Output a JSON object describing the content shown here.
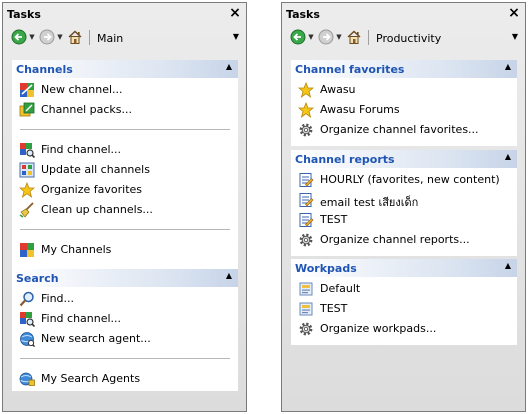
{
  "colors": {
    "group_header_text": "#1e55b4",
    "panel_bg": "#e3e3e3",
    "border": "#7a7a7a"
  },
  "left_panel": {
    "title": "Tasks",
    "toolbar": {
      "select_value": "Main"
    },
    "channels": {
      "header": "Channels",
      "items": [
        {
          "label": "New channel...",
          "icon": "new-channel-icon"
        },
        {
          "label": "Channel packs...",
          "icon": "channel-packs-icon"
        },
        {
          "label": "Find channel...",
          "icon": "find-channel-icon"
        },
        {
          "label": "Update all channels",
          "icon": "update-channels-icon"
        },
        {
          "label": "Organize favorites",
          "icon": "star-icon"
        },
        {
          "label": "Clean up channels...",
          "icon": "broom-icon"
        },
        {
          "label": "My Channels",
          "icon": "my-channels-icon"
        }
      ]
    },
    "search": {
      "header": "Search",
      "items": [
        {
          "label": "Find...",
          "icon": "magnifier-icon"
        },
        {
          "label": "Find channel...",
          "icon": "find-channel-icon"
        },
        {
          "label": "New search agent...",
          "icon": "search-agent-icon"
        },
        {
          "label": "My Search Agents",
          "icon": "search-agents-icon"
        }
      ]
    }
  },
  "right_panel": {
    "title": "Tasks",
    "toolbar": {
      "select_value": "Productivity"
    },
    "favorites": {
      "header": "Channel favorites",
      "items": [
        {
          "label": "Awasu",
          "icon": "star-icon"
        },
        {
          "label": "Awasu Forums",
          "icon": "star-icon"
        },
        {
          "label": "Organize channel favorites...",
          "icon": "gear-icon"
        }
      ]
    },
    "reports": {
      "header": "Channel reports",
      "items": [
        {
          "label": "HOURLY (favorites, new content)",
          "icon": "report-icon"
        },
        {
          "label": "email test เสียงเด็ก",
          "icon": "report-icon"
        },
        {
          "label": "TEST",
          "icon": "report-icon"
        },
        {
          "label": "Organize channel reports...",
          "icon": "gear-icon"
        }
      ]
    },
    "workpads": {
      "header": "Workpads",
      "items": [
        {
          "label": "Default",
          "icon": "workpad-icon"
        },
        {
          "label": "TEST",
          "icon": "workpad-icon"
        },
        {
          "label": "Organize workpads...",
          "icon": "gear-icon"
        }
      ]
    }
  }
}
